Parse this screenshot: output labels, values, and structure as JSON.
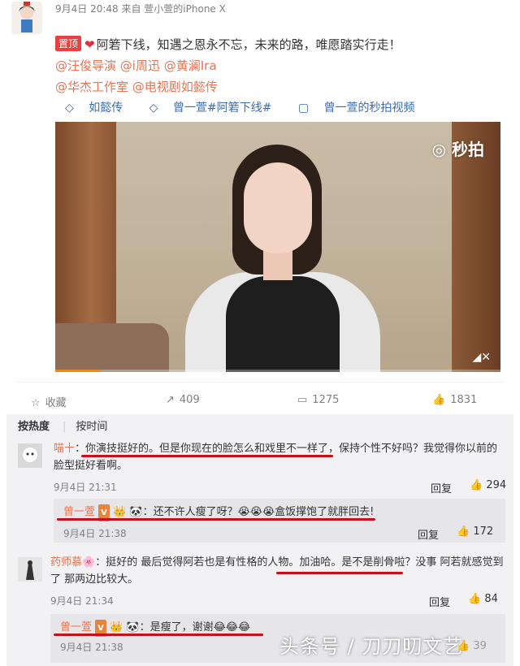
{
  "post": {
    "meta": "9月4日 20:48 来自 萱小萱的iPhone X",
    "pin_badge": "置顶",
    "text": "阿箬下线，知遇之恩永不忘，未来的路，唯愿踏实行走！",
    "mentions_line1": [
      "@汪俊导演",
      "@i周迅",
      "@黄澜Ira"
    ],
    "mentions_line2": [
      "@华杰工作室",
      "@电视剧如懿传"
    ],
    "topics": [
      "如懿传",
      "曾一萱#阿箬下线#",
      "曾一萱的秒拍视频"
    ],
    "video_watermark": "秒拍"
  },
  "actions": {
    "favorite": "收藏",
    "repost": "409",
    "comment": "1275",
    "like": "1831"
  },
  "comments_sort": {
    "hot": "按热度",
    "time": "按时间"
  },
  "comments": [
    {
      "name": "喵十",
      "text_a": "你演技挺好的。但是你现在的脸怎么和戏里不一样了，",
      "text_b": "保持个性不好吗？我觉得你以前的脸型挺好看啊。",
      "time": "9月4日 21:31",
      "reply_label": "回复",
      "likes": "294",
      "reply": {
        "name": "曾一萱",
        "text": "：还不许人瘦了呀？",
        "text2": "盒饭撑饱了就胖回去!",
        "time": "9月4日 21:38",
        "reply_label": "回复",
        "likes": "172"
      }
    },
    {
      "name": "药师慕",
      "text_a": "：挺好的 最后觉得阿若也是有性格的人物。加油哈。是不是削骨啦？没事 阿若就感觉到",
      "text_b": "了 那两边比较大。",
      "time": "9月4日 21:34",
      "reply_label": "回复",
      "likes": "84",
      "reply": {
        "name": "曾一萱",
        "text": "：是瘦了，谢谢",
        "time": "9月4日 21:38",
        "likes": "39"
      }
    }
  ],
  "watermark": "头条号 / 刀刀叨文艺"
}
